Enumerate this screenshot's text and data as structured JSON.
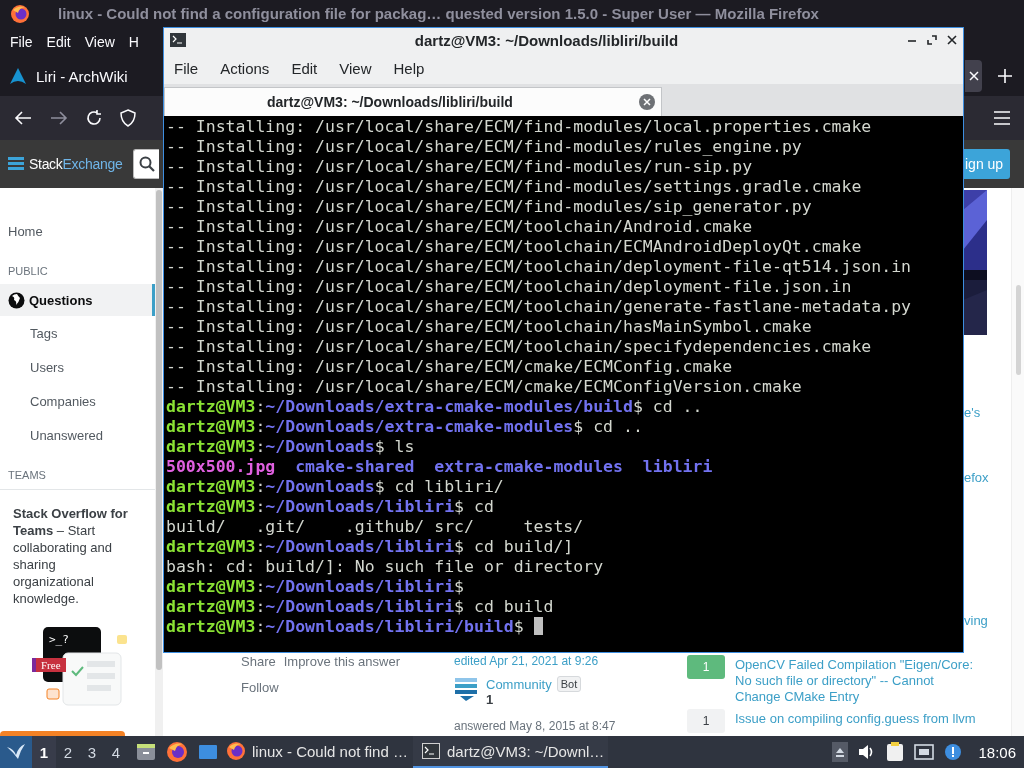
{
  "browser": {
    "title": "linux - Could not find a configuration file for packag…  quested version 1.5.0 - Super User — Mozilla Firefox",
    "menu": [
      "File",
      "Edit",
      "View",
      "H"
    ],
    "tabs": [
      {
        "label": "Liri - ArchWiki",
        "selected": false
      },
      {
        "selected": true
      }
    ]
  },
  "site_header": {
    "logo_first": "Stack",
    "logo_second": "Exchange",
    "signup": "ign up"
  },
  "sidebar": {
    "home": {
      "label": "Home",
      "selected": false
    },
    "sections": [
      {
        "heading": "PUBLIC",
        "items": [
          {
            "label": "Questions",
            "kind": "globe",
            "selected": true
          },
          {
            "label": "Tags",
            "kind": "indented",
            "selected": false
          },
          {
            "label": "Users",
            "kind": "indented",
            "selected": false
          },
          {
            "label": "Companies",
            "kind": "indented",
            "selected": false
          },
          {
            "label": "Unanswered",
            "kind": "indented",
            "selected": false
          }
        ]
      },
      {
        "heading": "TEAMS"
      }
    ],
    "teams": {
      "text": "**Stack Overflow for Teams** – Start collaborating and sharing organizational knowledge.",
      "prompt": ">_?",
      "badge": "Free"
    }
  },
  "answer": {
    "actions": [
      "Share",
      "Improve this answer"
    ],
    "follow": "Follow",
    "edited": "edited Apr 21, 2021 at 9:26",
    "editor": {
      "name": "Community",
      "badge": "Bot",
      "reputation": "1"
    },
    "answered": "answered May 8, 2015 at 8:47"
  },
  "right_fragments": [
    "e's",
    "efox",
    "ving"
  ],
  "linked": [
    {
      "score": "1",
      "accepted": true,
      "title": "OpenCV Failed Compilation \"Eigen/Core: No such file or directory\" -- Cannot Change CMake Entry"
    },
    {
      "score": "1",
      "accepted": false,
      "title": "Issue on compiling config.guess from llvm"
    }
  ],
  "terminal": {
    "title": "dartz@VM3: ~/Downloads/libliri/build",
    "menu": [
      "File",
      "Actions",
      "Edit",
      "View",
      "Help"
    ],
    "tabs": [
      {
        "label": "dartz@VM3: ~/Downloads/libliri/build",
        "selected": true
      }
    ],
    "cursor": true,
    "lines": [
      {
        "segments": [
          {
            "kind": "plain",
            "text": "-- Installing: /usr/local/share/ECM/find-modules/local.properties.cmake"
          }
        ]
      },
      {
        "segments": [
          {
            "kind": "plain",
            "text": "-- Installing: /usr/local/share/ECM/find-modules/rules_engine.py"
          }
        ]
      },
      {
        "segments": [
          {
            "kind": "plain",
            "text": "-- Installing: /usr/local/share/ECM/find-modules/run-sip.py"
          }
        ]
      },
      {
        "segments": [
          {
            "kind": "plain",
            "text": "-- Installing: /usr/local/share/ECM/find-modules/settings.gradle.cmake"
          }
        ]
      },
      {
        "segments": [
          {
            "kind": "plain",
            "text": "-- Installing: /usr/local/share/ECM/find-modules/sip_generator.py"
          }
        ]
      },
      {
        "segments": [
          {
            "kind": "plain",
            "text": "-- Installing: /usr/local/share/ECM/toolchain/Android.cmake"
          }
        ]
      },
      {
        "segments": [
          {
            "kind": "plain",
            "text": "-- Installing: /usr/local/share/ECM/toolchain/ECMAndroidDeployQt.cmake"
          }
        ]
      },
      {
        "segments": [
          {
            "kind": "plain",
            "text": "-- Installing: /usr/local/share/ECM/toolchain/deployment-file-qt514.json.in"
          }
        ]
      },
      {
        "segments": [
          {
            "kind": "plain",
            "text": "-- Installing: /usr/local/share/ECM/toolchain/deployment-file.json.in"
          }
        ]
      },
      {
        "segments": [
          {
            "kind": "plain",
            "text": "-- Installing: /usr/local/share/ECM/toolchain/generate-fastlane-metadata.py"
          }
        ]
      },
      {
        "segments": [
          {
            "kind": "plain",
            "text": "-- Installing: /usr/local/share/ECM/toolchain/hasMainSymbol.cmake"
          }
        ]
      },
      {
        "segments": [
          {
            "kind": "plain",
            "text": "-- Installing: /usr/local/share/ECM/toolchain/specifydependencies.cmake"
          }
        ]
      },
      {
        "segments": [
          {
            "kind": "plain",
            "text": "-- Installing: /usr/local/share/ECM/cmake/ECMConfig.cmake"
          }
        ]
      },
      {
        "segments": [
          {
            "kind": "plain",
            "text": "-- Installing: /usr/local/share/ECM/cmake/ECMConfigVersion.cmake"
          }
        ]
      },
      {
        "segments": [
          {
            "kind": "user",
            "text": "dartz@VM3"
          },
          {
            "kind": "plain",
            "text": ":"
          },
          {
            "kind": "path",
            "text": "~/Downloads/extra-cmake-modules/build"
          },
          {
            "kind": "plain",
            "text": "$ cd .."
          }
        ]
      },
      {
        "segments": [
          {
            "kind": "user",
            "text": "dartz@VM3"
          },
          {
            "kind": "plain",
            "text": ":"
          },
          {
            "kind": "path",
            "text": "~/Downloads/extra-cmake-modules"
          },
          {
            "kind": "plain",
            "text": "$ cd .."
          }
        ]
      },
      {
        "segments": [
          {
            "kind": "user",
            "text": "dartz@VM3"
          },
          {
            "kind": "plain",
            "text": ":"
          },
          {
            "kind": "path",
            "text": "~/Downloads"
          },
          {
            "kind": "plain",
            "text": "$ ls"
          }
        ]
      },
      {
        "segments": [
          {
            "text": "500x500.jpg"
          },
          {
            "kind": "dir",
            "text": "  cmake-shared"
          },
          {
            "kind": "dir",
            "text": "  extra-cmake-modules"
          },
          {
            "kind": "dir",
            "text": "  libliri"
          }
        ]
      },
      {
        "segments": [
          {
            "kind": "user",
            "text": "dartz@VM3"
          },
          {
            "kind": "plain",
            "text": ":"
          },
          {
            "kind": "path",
            "text": "~/Downloads"
          },
          {
            "kind": "plain",
            "text": "$ cd libliri/"
          }
        ]
      },
      {
        "segments": [
          {
            "kind": "user",
            "text": "dartz@VM3"
          },
          {
            "kind": "plain",
            "text": ":"
          },
          {
            "kind": "path",
            "text": "~/Downloads/libliri"
          },
          {
            "kind": "plain",
            "text": "$ cd"
          }
        ]
      },
      {
        "segments": [
          {
            "kind": "plain",
            "text": "build/   .git/    .github/ src/     tests/"
          }
        ]
      },
      {
        "segments": [
          {
            "kind": "user",
            "text": "dartz@VM3"
          },
          {
            "kind": "plain",
            "text": ":"
          },
          {
            "kind": "path",
            "text": "~/Downloads/libliri"
          },
          {
            "kind": "plain",
            "text": "$ cd build/]"
          }
        ]
      },
      {
        "segments": [
          {
            "kind": "plain",
            "text": "bash: cd: build/]: No such file or directory"
          }
        ]
      },
      {
        "segments": [
          {
            "kind": "user",
            "text": "dartz@VM3"
          },
          {
            "kind": "plain",
            "text": ":"
          },
          {
            "kind": "path",
            "text": "~/Downloads/libliri"
          },
          {
            "kind": "plain",
            "text": "$"
          }
        ]
      },
      {
        "segments": [
          {
            "kind": "user",
            "text": "dartz@VM3"
          },
          {
            "kind": "plain",
            "text": ":"
          },
          {
            "kind": "path",
            "text": "~/Downloads/libliri"
          },
          {
            "kind": "plain",
            "text": "$ cd build"
          }
        ]
      },
      {
        "segments": [
          {
            "kind": "user",
            "text": "dartz@VM3"
          },
          {
            "kind": "plain",
            "text": ":"
          },
          {
            "kind": "path",
            "text": "~/Downloads/libliri/build"
          },
          {
            "kind": "plain",
            "text": "$"
          }
        ]
      }
    ]
  },
  "taskbar": {
    "workspaces": [
      {
        "label": "1",
        "selected": true
      },
      {
        "label": "2",
        "selected": false
      },
      {
        "label": "3",
        "selected": false
      },
      {
        "label": "4",
        "selected": false
      }
    ],
    "tasks": [
      {
        "label": "linux - Could not find …",
        "kind": "firefox",
        "selected": false
      },
      {
        "label": "dartz@VM3: ~/Downl…",
        "kind": "terminal",
        "selected": true
      }
    ],
    "clock": "18:06"
  }
}
